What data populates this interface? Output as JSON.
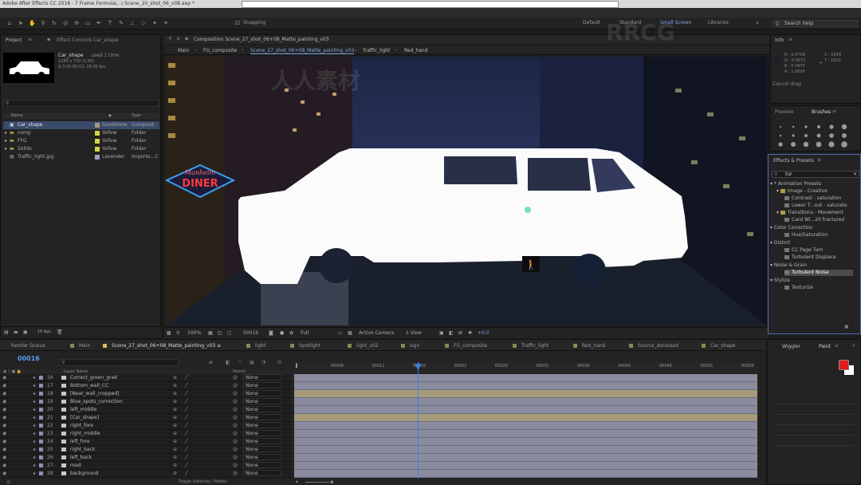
{
  "window": {
    "title": "Adobe After Effects CC 2018 - 7 Frame Formula\\...\\ Scene_20_shot_06_v08.aep *"
  },
  "toolbar": {
    "snapping_label": "Snapping",
    "workspaces": [
      "Default",
      "Standard",
      "Small Screen",
      "Libraries"
    ],
    "search_placeholder": "Search Help"
  },
  "project": {
    "tab_label": "Project",
    "effect_controls_label": "Effect Controls Car_shape",
    "selected": {
      "name": "Car_shape",
      "used": "used 1 time",
      "dims": "1280 x 720 (1.00)",
      "duration": "Δ 0:00:00:03, 24.00 fps"
    },
    "columns": [
      "Name",
      "Type"
    ],
    "items": [
      {
        "name": "Car_shape",
        "label": "Sandstone",
        "type": "Composit",
        "color": "#a59b79"
      },
      {
        "name": "comp",
        "label": "Yellow",
        "type": "Folder",
        "color": "#d6d24a"
      },
      {
        "name": "FFG",
        "label": "Yellow",
        "type": "Folder",
        "color": "#d6d24a"
      },
      {
        "name": "Solids",
        "label": "Yellow",
        "type": "Folder",
        "color": "#d6d24a"
      },
      {
        "name": "Traffic_light.jpg",
        "label": "Lavender",
        "type": "Importe...C",
        "color": "#a89ac6"
      }
    ],
    "bpc": "16 bpc"
  },
  "composition": {
    "tab_label": "Composition Scene_27_shot_06+08_Matte_painting_v03",
    "breadcrumbs": [
      "Main",
      "FG_composite",
      "Scene_27_shot_06+08_Matte_painting_v03",
      "Traffic_light",
      "Red_hand"
    ],
    "footer": {
      "zoom": "100%",
      "time": "00016",
      "resolution": "Full",
      "camera": "Active Camera",
      "view": "1 View",
      "exposure": "+0.0"
    },
    "sign_line1": "Manheim",
    "sign_line2": "DINER"
  },
  "info": {
    "tab_label": "Info",
    "r": "R : 0.0709",
    "g": "G : 0.0673",
    "b": "B : 0.0975",
    "a": "A : 1.0000",
    "x": "X : 1049",
    "y": "Y : 1010",
    "status": "Cancel drag"
  },
  "preview": {
    "tab_label": "Preview",
    "brushes_label": "Brushes"
  },
  "effects": {
    "tab_label": "Effects & Presets",
    "search_value": "tur",
    "items": [
      {
        "label": "* Animation Presets",
        "level": 0
      },
      {
        "label": "Image - Creative",
        "level": 1
      },
      {
        "label": "Contrast - saturation",
        "level": 2
      },
      {
        "label": "Lower T...out - saturate",
        "level": 2
      },
      {
        "label": "Transitions - Movement",
        "level": 1
      },
      {
        "label": "Card Wi...20 fractured",
        "level": 2
      },
      {
        "label": "Color Correction",
        "level": 0
      },
      {
        "label": "Hue/Saturation",
        "level": 1
      },
      {
        "label": "Distort",
        "level": 0
      },
      {
        "label": "CC Page Turn",
        "level": 1
      },
      {
        "label": "Turbulent Displace",
        "level": 1
      },
      {
        "label": "Noise & Grain",
        "level": 0
      },
      {
        "label": "Turbulent Noise",
        "level": 1
      },
      {
        "label": "Stylize",
        "level": 0
      },
      {
        "label": "Texturize",
        "level": 1
      }
    ]
  },
  "timeline": {
    "tabs": [
      "Render Queue",
      "Main",
      "Scene_27_shot_06+08_Matte_painting_v03",
      "light",
      "Spotlight",
      "light_v02",
      "sign",
      "FG_composite",
      "Traffic_light",
      "Red_hand",
      "Source_denoised",
      "Car_shape"
    ],
    "current_time": "00016",
    "columns": {
      "layer_name": "Layer Name",
      "parent": "Parent"
    },
    "ruler": [
      "00006",
      "00011",
      "00016",
      "00021",
      "00026",
      "00031",
      "00036",
      "00041",
      "00046",
      "00051",
      "00056"
    ],
    "layers": [
      {
        "num": "16",
        "name": "Correct_green_grad",
        "parent": "None"
      },
      {
        "num": "17",
        "name": "Bottom_wall_CC",
        "parent": "None"
      },
      {
        "num": "18",
        "name": "[Near_wall_cropped]",
        "parent": "None"
      },
      {
        "num": "19",
        "name": "Blue_spots_correction",
        "parent": "None"
      },
      {
        "num": "20",
        "name": "left_middle",
        "parent": "None"
      },
      {
        "num": "21",
        "name": "[Car_shape]",
        "parent": "None"
      },
      {
        "num": "22",
        "name": "right_fore",
        "parent": "None"
      },
      {
        "num": "23",
        "name": "right_middle",
        "parent": "None"
      },
      {
        "num": "24",
        "name": "left_fore",
        "parent": "None"
      },
      {
        "num": "25",
        "name": "right_back",
        "parent": "None"
      },
      {
        "num": "26",
        "name": "left_back",
        "parent": "None"
      },
      {
        "num": "27",
        "name": "road",
        "parent": "None"
      },
      {
        "num": "28",
        "name": "background",
        "parent": "None"
      }
    ],
    "footer_label": "Toggle Switches / Modes"
  },
  "paint": {
    "wiggler_label": "Wiggler",
    "paint_label": "Paint",
    "fg_color": "#e01b1b",
    "bg_color": "#ffffff"
  },
  "watermark": {
    "text1": "RRCG",
    "text2": "人人素材"
  }
}
